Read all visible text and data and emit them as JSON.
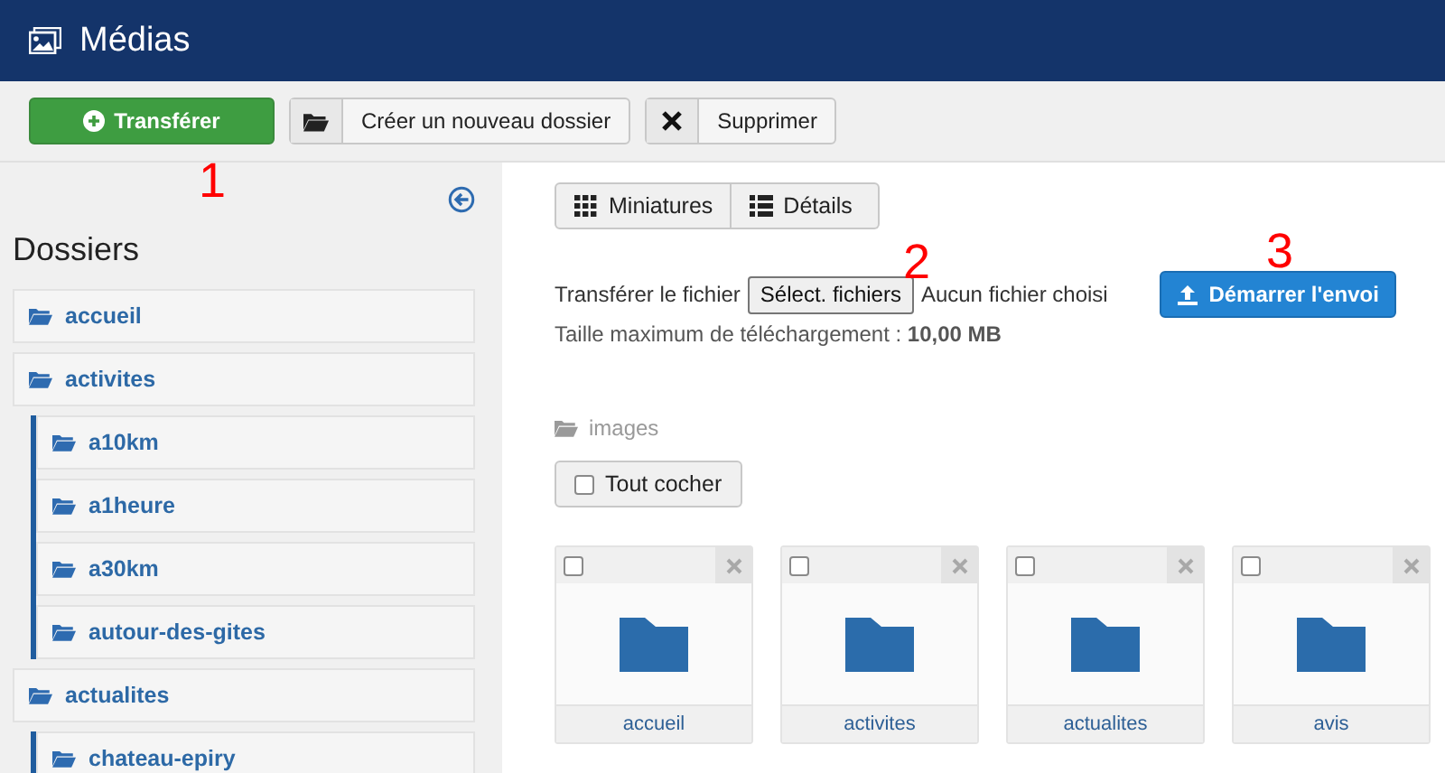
{
  "header": {
    "title": "Médias"
  },
  "toolbar": {
    "buttons": [
      {
        "label": "Transférer",
        "kind": "primary"
      },
      {
        "label": "Créer un nouveau dossier",
        "kind": "folder"
      },
      {
        "label": "Supprimer",
        "kind": "delete"
      }
    ]
  },
  "sidebar": {
    "title": "Dossiers",
    "folders": [
      {
        "name": "accueil"
      },
      {
        "name": "activites",
        "children": [
          {
            "name": "a10km"
          },
          {
            "name": "a1heure"
          },
          {
            "name": "a30km"
          },
          {
            "name": "autour-des-gites"
          }
        ]
      },
      {
        "name": "actualites",
        "children": [
          {
            "name": "chateau-epiry"
          }
        ]
      }
    ]
  },
  "view_switch": [
    {
      "label": "Miniatures",
      "kind": "grid"
    },
    {
      "label": "Détails",
      "kind": "list"
    }
  ],
  "upload": {
    "label": "Transférer le fichier",
    "file_button": "Sélect. fichiers",
    "file_status": "Aucun fichier choisi",
    "max_size": "Taille maximum de téléchargement : **10,00 MB**",
    "start_button": "Démarrer l'envoi"
  },
  "breadcrumb": "images",
  "check_all": {
    "label": "Tout cocher",
    "checked": false
  },
  "items": [
    {
      "name": "accueil",
      "checked": false
    },
    {
      "name": "activites",
      "checked": false
    },
    {
      "name": "actualites",
      "checked": false
    },
    {
      "name": "avis",
      "checked": false
    }
  ],
  "annotations": [
    "1",
    "2",
    "3"
  ]
}
